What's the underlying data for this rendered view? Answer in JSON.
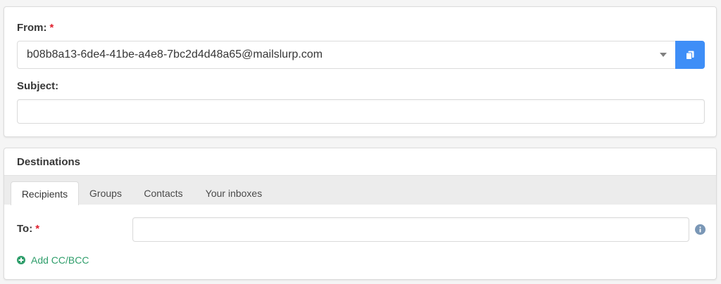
{
  "from": {
    "label": "From:",
    "required_marker": "*",
    "selected_email": "b08b8a13-6de4-41be-a4e8-7bc2d4d48a65@mailslurp.com",
    "copy_icon": "copy-icon"
  },
  "subject": {
    "label": "Subject:",
    "value": ""
  },
  "destinations": {
    "title": "Destinations",
    "tabs": [
      {
        "label": "Recipients",
        "active": true
      },
      {
        "label": "Groups",
        "active": false
      },
      {
        "label": "Contacts",
        "active": false
      },
      {
        "label": "Your inboxes",
        "active": false
      }
    ],
    "to": {
      "label": "To:",
      "required_marker": "*",
      "value": "",
      "info_icon": "info-icon"
    },
    "add_cc_bcc": {
      "label": "Add CC/BCC",
      "icon": "plus-circle-icon"
    }
  },
  "colors": {
    "primary": "#3e8ef7",
    "required": "#e0202e",
    "add_link": "#2f9e6b",
    "info_icon": "#7a97b6"
  }
}
